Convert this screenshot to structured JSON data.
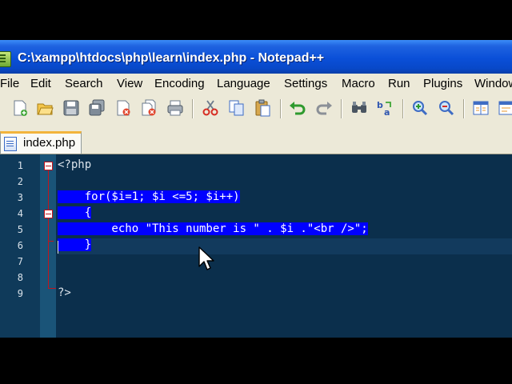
{
  "window": {
    "title": "C:\\xampp\\htdocs\\php\\learn\\index.php - Notepad++"
  },
  "menu": {
    "items": [
      "File",
      "Edit",
      "Search",
      "View",
      "Encoding",
      "Language",
      "Settings",
      "Macro",
      "Run",
      "Plugins",
      "Window"
    ]
  },
  "toolbar": {
    "icons": [
      "new-file-icon",
      "open-file-icon",
      "save-icon",
      "save-all-icon",
      "close-icon",
      "close-all-icon",
      "print-icon",
      "cut-icon",
      "copy-icon",
      "paste-icon",
      "undo-icon",
      "redo-icon",
      "find-icon",
      "replace-icon",
      "zoom-in-icon",
      "zoom-out-icon",
      "sync-scroll-icon",
      "wrap-icon"
    ]
  },
  "tab": {
    "label": "index.php"
  },
  "editor": {
    "line_numbers": [
      "1",
      "2",
      "3",
      "4",
      "5",
      "6",
      "7",
      "8",
      "9"
    ],
    "lines": [
      "<?php",
      "",
      "    for($i=1; $i <=5; $i++)",
      "    {",
      "        echo \"This number is \" . $i .\"<br />\";",
      "    }",
      "",
      "",
      "?>"
    ],
    "selected_lines": [
      3,
      4,
      5,
      6
    ],
    "caret_line": 7,
    "colors": {
      "background": "#0B2F4C",
      "selection": "#0000FF",
      "fold_marker": "#C0141D"
    }
  }
}
